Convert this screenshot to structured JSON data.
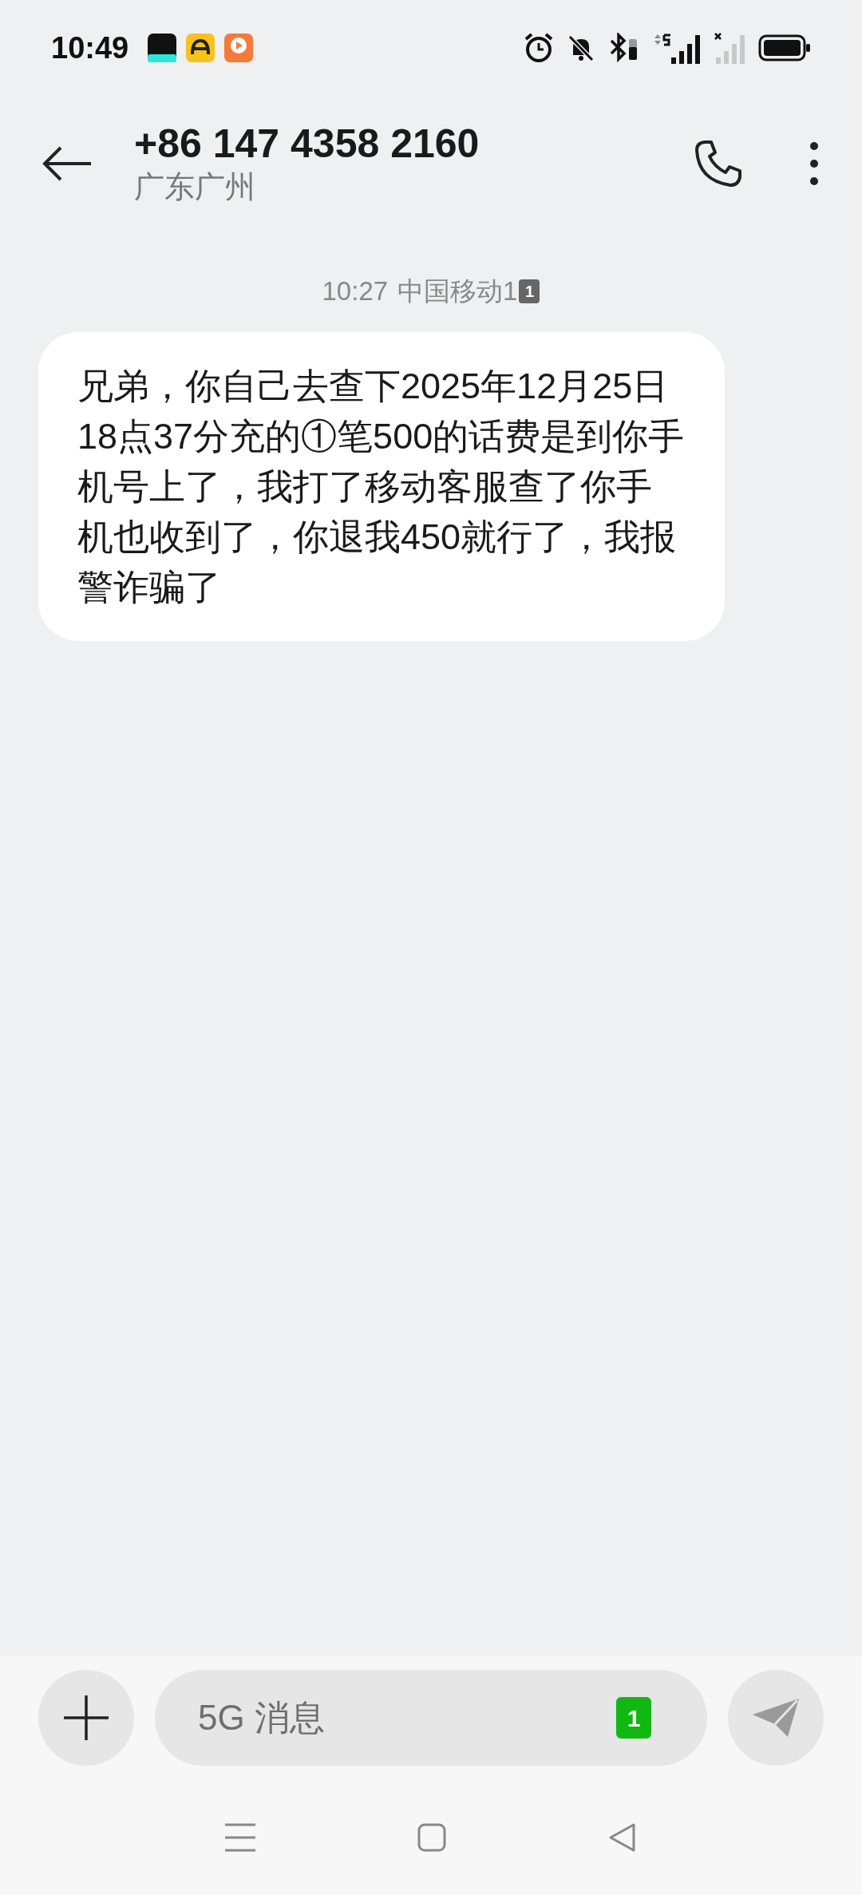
{
  "status_bar": {
    "time": "10:49"
  },
  "header": {
    "title": "+86 147 4358 2160",
    "subtitle": "广东广州"
  },
  "messages": [
    {
      "time": "10:27",
      "carrier": "中国移动1",
      "sim": "1",
      "text": "兄弟，你自己去查下2025年12月25日18点37分充的①笔500的话费是到你手机号上了，我打了移动客服查了你手机也收到了，你退我450就行了，我报警诈骗了"
    }
  ],
  "composer": {
    "placeholder": "5G 消息",
    "sim": "1"
  }
}
